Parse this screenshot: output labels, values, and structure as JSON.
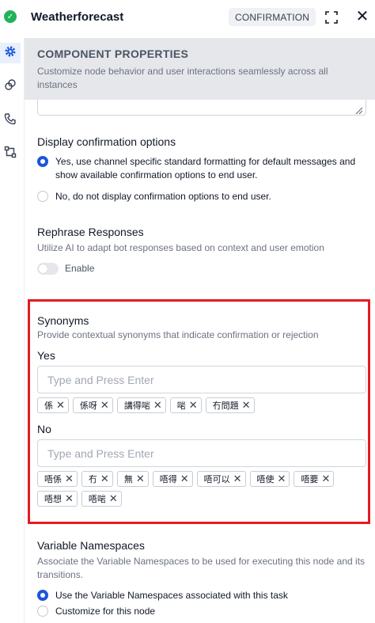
{
  "header": {
    "title": "Weatherforecast",
    "badge": "CONFIRMATION",
    "status_icon": "check-circle-icon",
    "expand_icon": "expand-icon",
    "close_icon": "close-icon",
    "close_glyph": "✕"
  },
  "rail": {
    "items": [
      {
        "name": "settings",
        "icon": "gear-icon",
        "active": true
      },
      {
        "name": "connections",
        "icon": "link-icon",
        "active": false
      },
      {
        "name": "voice",
        "icon": "phone-icon",
        "active": false
      },
      {
        "name": "flow",
        "icon": "branch-icon",
        "active": false
      }
    ]
  },
  "component_properties": {
    "title": "COMPONENT PROPERTIES",
    "description": "Customize node behavior and user interactions seamlessly across all instances"
  },
  "display_confirmation": {
    "title": "Display confirmation options",
    "options": [
      {
        "label": "Yes, use channel specific standard formatting for default messages and show available confirmation options to end user.",
        "checked": true
      },
      {
        "label": "No, do not display confirmation options to end user.",
        "checked": false
      }
    ]
  },
  "rephrase": {
    "title": "Rephrase Responses",
    "description": "Utilize AI to adapt bot responses based on context and user emotion",
    "toggle_label": "Enable",
    "enabled": false
  },
  "synonyms": {
    "title": "Synonyms",
    "description": "Provide contextual synonyms that indicate confirmation or rejection",
    "yes": {
      "label": "Yes",
      "placeholder": "Type and Press Enter",
      "tags": [
        "係",
        "係呀",
        "講得啱",
        "啱",
        "冇問題"
      ]
    },
    "no": {
      "label": "No",
      "placeholder": "Type and Press Enter",
      "tags": [
        "唔係",
        "冇",
        "無",
        "唔得",
        "唔可以",
        "唔使",
        "唔要",
        "唔想",
        "唔啱"
      ]
    },
    "highlight_color": "#e41b23"
  },
  "variable_namespaces": {
    "title": "Variable Namespaces",
    "description": "Associate the Variable Namespaces to be used for executing this node and its transitions.",
    "options": [
      {
        "label": "Use the Variable Namespaces associated with this task",
        "checked": true
      },
      {
        "label": "Customize for this node",
        "checked": false
      }
    ]
  },
  "colors": {
    "accent": "#1a56db",
    "success": "#22b35a"
  }
}
